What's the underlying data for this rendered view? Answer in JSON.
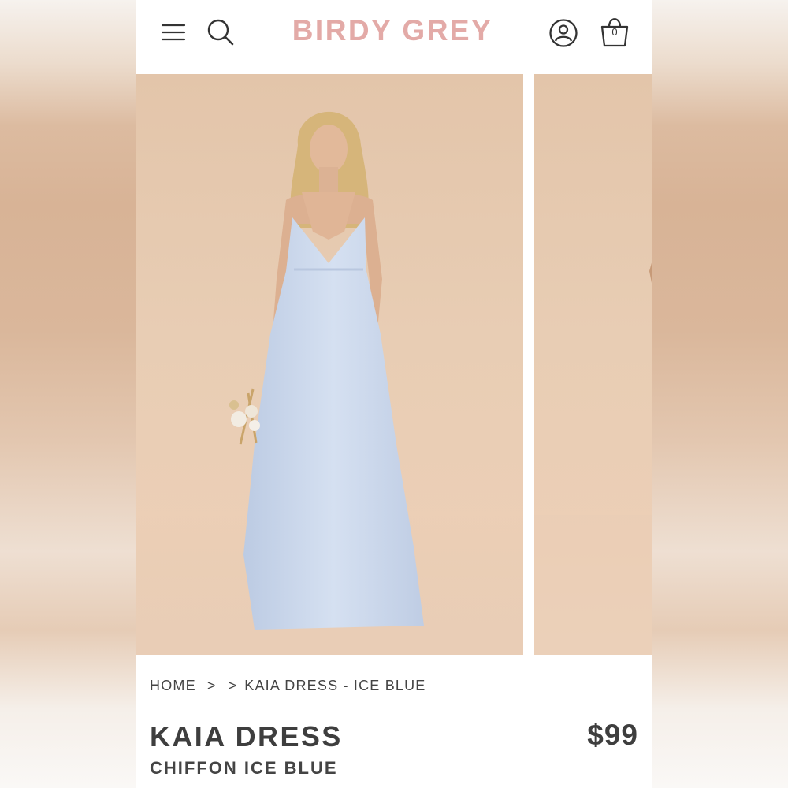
{
  "header": {
    "brand": "BIRDY GREY",
    "cart_count": "0",
    "icons": {
      "menu": "hamburger-menu-icon",
      "search": "search-icon",
      "account": "user-account-icon",
      "cart": "shopping-bag-icon"
    },
    "brand_color": "#e3aaa7"
  },
  "gallery": {
    "images": [
      "model-wearing-kaia-dress-front",
      "model-wearing-kaia-dress-partial"
    ]
  },
  "breadcrumb": {
    "home": "HOME",
    "separator_1": ">",
    "separator_2": ">",
    "current": "KAIA DRESS - ICE BLUE"
  },
  "product": {
    "name": "KAIA DRESS",
    "subtitle": "CHIFFON ICE BLUE",
    "price": "$99"
  },
  "colors": {
    "text": "#3e3e3e",
    "background": "#ffffff",
    "photo_backdrop": "#e6cab0",
    "dress": "#cdd9ee"
  }
}
